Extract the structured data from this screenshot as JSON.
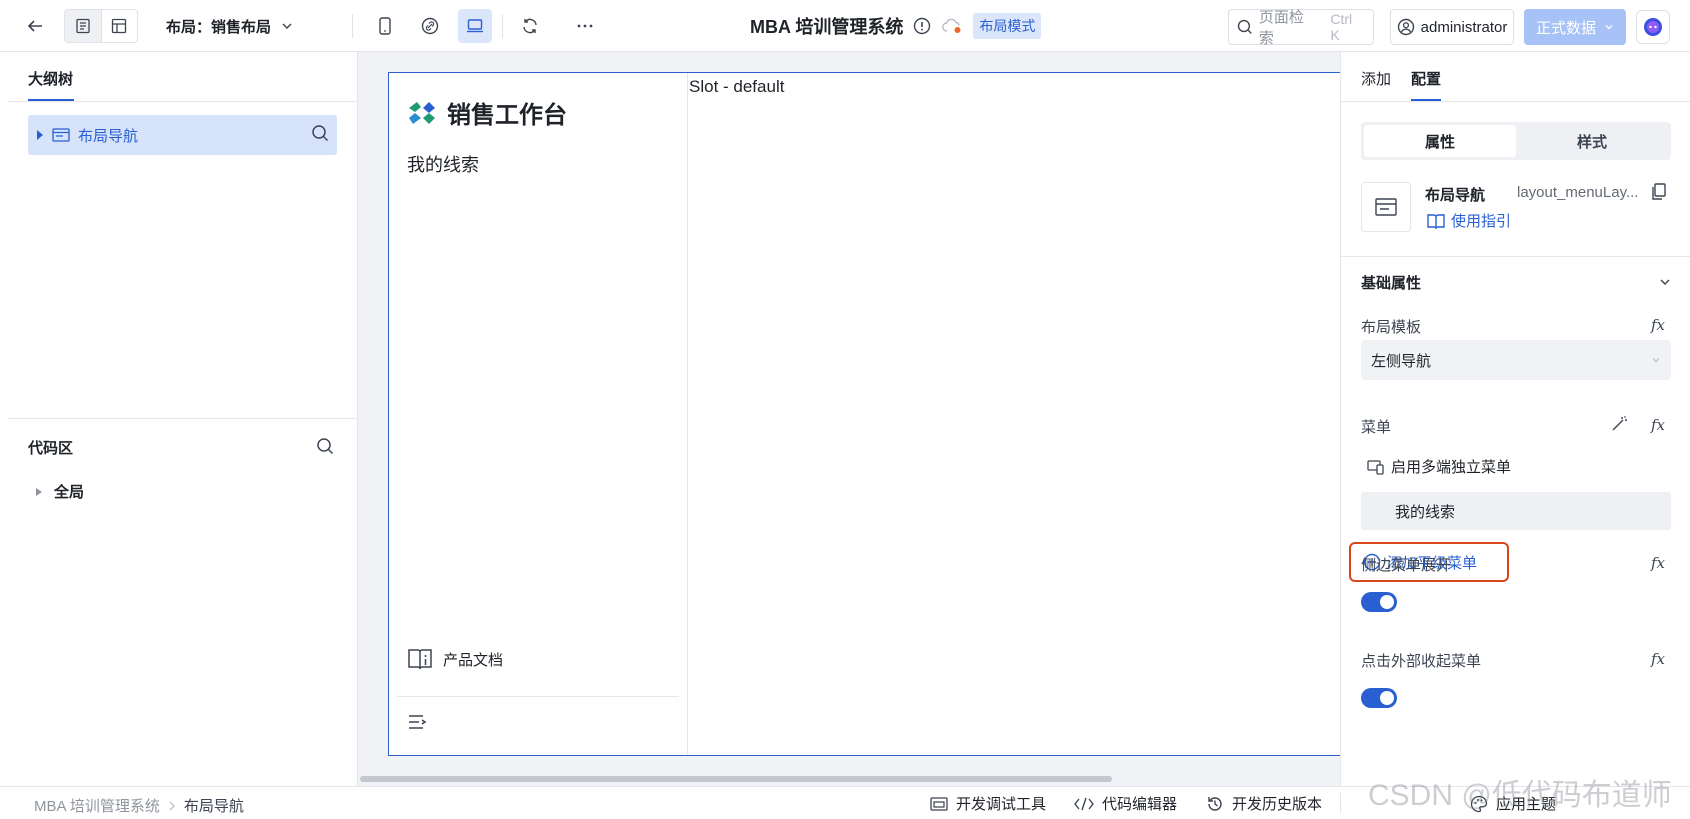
{
  "topbar": {
    "layout_label": "布局：销售布局",
    "app_title": "MBA 培训管理系统",
    "mode_badge": "布局模式",
    "search_placeholder": "页面检索",
    "search_shortcut": "Ctrl K",
    "user": "administrator",
    "data_mode": "正式数据"
  },
  "left_panel": {
    "outline_tab": "大纲树",
    "tree_item": "布局导航",
    "code_title": "代码区",
    "code_item": "全局"
  },
  "canvas": {
    "brand": "销售工作台",
    "menu_item": "我的线索",
    "docs": "产品文档",
    "slot": "Slot - default"
  },
  "right_panel": {
    "tabs": [
      "添加",
      "配置"
    ],
    "switch_options": [
      "属性",
      "样式"
    ],
    "component_name": "布局导航",
    "component_id": "layout_menuLay...",
    "guide": "使用指引",
    "group_title": "基础属性",
    "layout_template_label": "布局模板",
    "layout_template_value": "左侧导航",
    "menu_label": "菜单",
    "multi_menu": "启用多端独立菜单",
    "menu_row": "我的线索",
    "add_menu": "添加平级菜单",
    "sider_expand_label": "侧边菜单展开",
    "outside_collapse_label": "点击外部收起菜单",
    "fx": "fx"
  },
  "footer": {
    "breadcrumb": [
      "MBA 培训管理系统",
      "布局导航"
    ],
    "dev_tools": "开发调试工具",
    "code_editor": "代码编辑器",
    "history": "开发历史版本",
    "theme": "应用主题"
  },
  "watermark": "CSDN @低代码布道师",
  "colors": {
    "accent": "#2a5fd1",
    "highlight_border": "#d9461c",
    "selected_bg": "#d6e3fa"
  }
}
